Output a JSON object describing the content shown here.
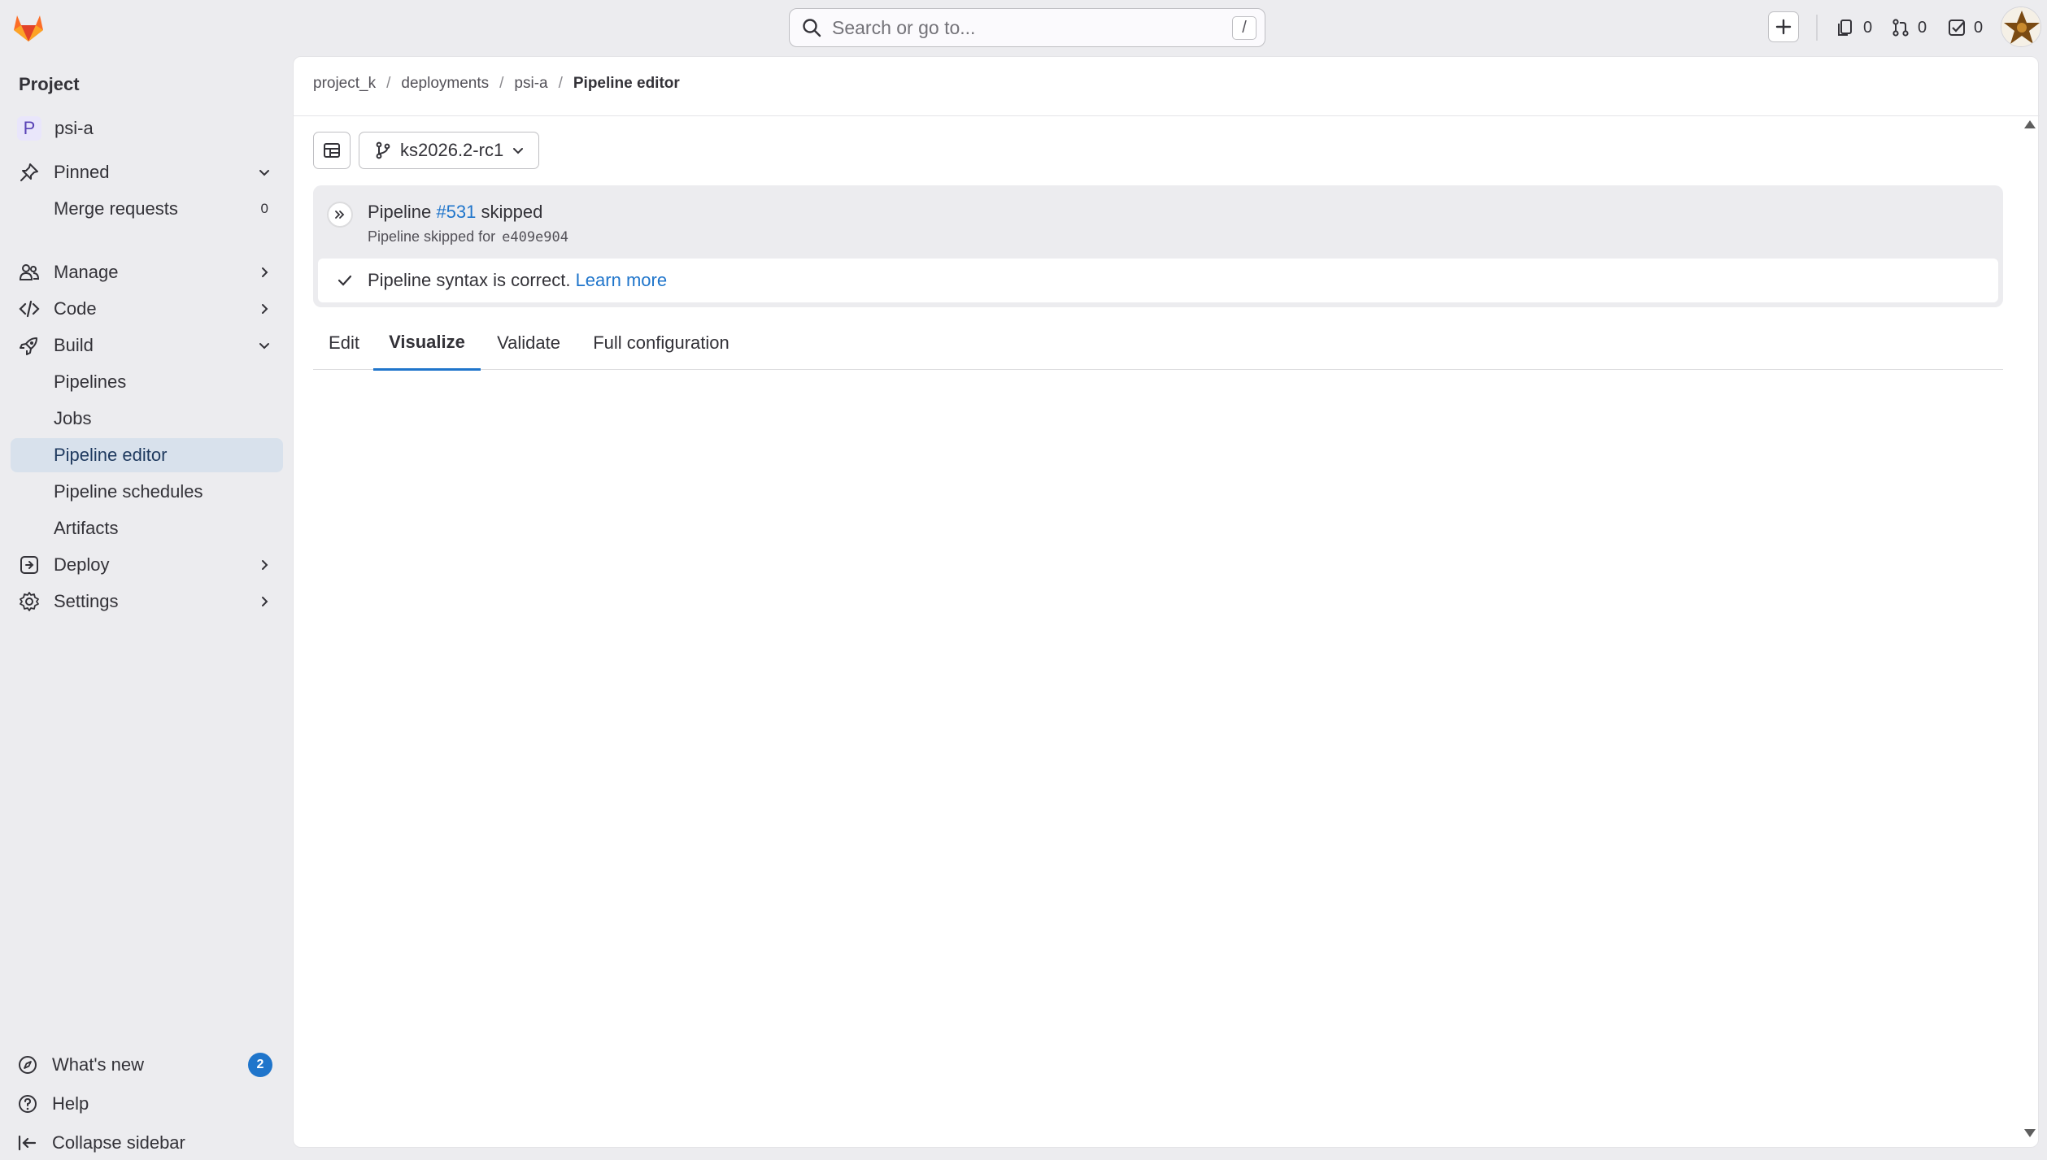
{
  "topbar": {
    "search_placeholder": "Search or go to...",
    "search_shortcut": "/",
    "counters": {
      "issues": "0",
      "merge_requests": "0",
      "todos": "0"
    }
  },
  "sidebar": {
    "heading": "Project",
    "project_initial": "P",
    "project_name": "psi-a",
    "items": [
      {
        "label": "Pinned",
        "icon": "pin-icon",
        "chevron": "down"
      },
      {
        "label": "Merge requests",
        "count": "0"
      },
      {
        "label": "Manage",
        "icon": "users-icon",
        "chevron": "right"
      },
      {
        "label": "Code",
        "icon": "code-icon",
        "chevron": "right"
      },
      {
        "label": "Build",
        "icon": "rocket-icon",
        "chevron": "down"
      },
      {
        "label": "Pipelines"
      },
      {
        "label": "Jobs"
      },
      {
        "label": "Pipeline editor",
        "active": true
      },
      {
        "label": "Pipeline schedules"
      },
      {
        "label": "Artifacts"
      },
      {
        "label": "Deploy",
        "icon": "deploy-icon",
        "chevron": "right"
      },
      {
        "label": "Settings",
        "icon": "gear-icon",
        "chevron": "right"
      }
    ],
    "footer": {
      "whats_new": "What's new",
      "whats_new_badge": "2",
      "help": "Help",
      "collapse": "Collapse sidebar"
    }
  },
  "breadcrumb": [
    "project_k",
    "deployments",
    "psi-a",
    "Pipeline editor"
  ],
  "editor": {
    "branch": "ks2026.2-rc1",
    "pipeline_prefix": "Pipeline",
    "pipeline_id": "#531",
    "pipeline_status": "skipped",
    "pipeline_sub": "Pipeline skipped for",
    "commit_sha": "e409e904",
    "lint_text": "Pipeline syntax is correct.",
    "lint_link": "Learn more",
    "tabs": [
      {
        "label": "Edit",
        "active": false
      },
      {
        "label": "Visualize",
        "active": true
      },
      {
        "label": "Validate",
        "active": false
      },
      {
        "label": "Full configuration",
        "active": false
      }
    ]
  },
  "colors": {
    "accent": "#1f75cb",
    "active_nav": "#d8e1ec",
    "page_bg": "#ececef"
  }
}
